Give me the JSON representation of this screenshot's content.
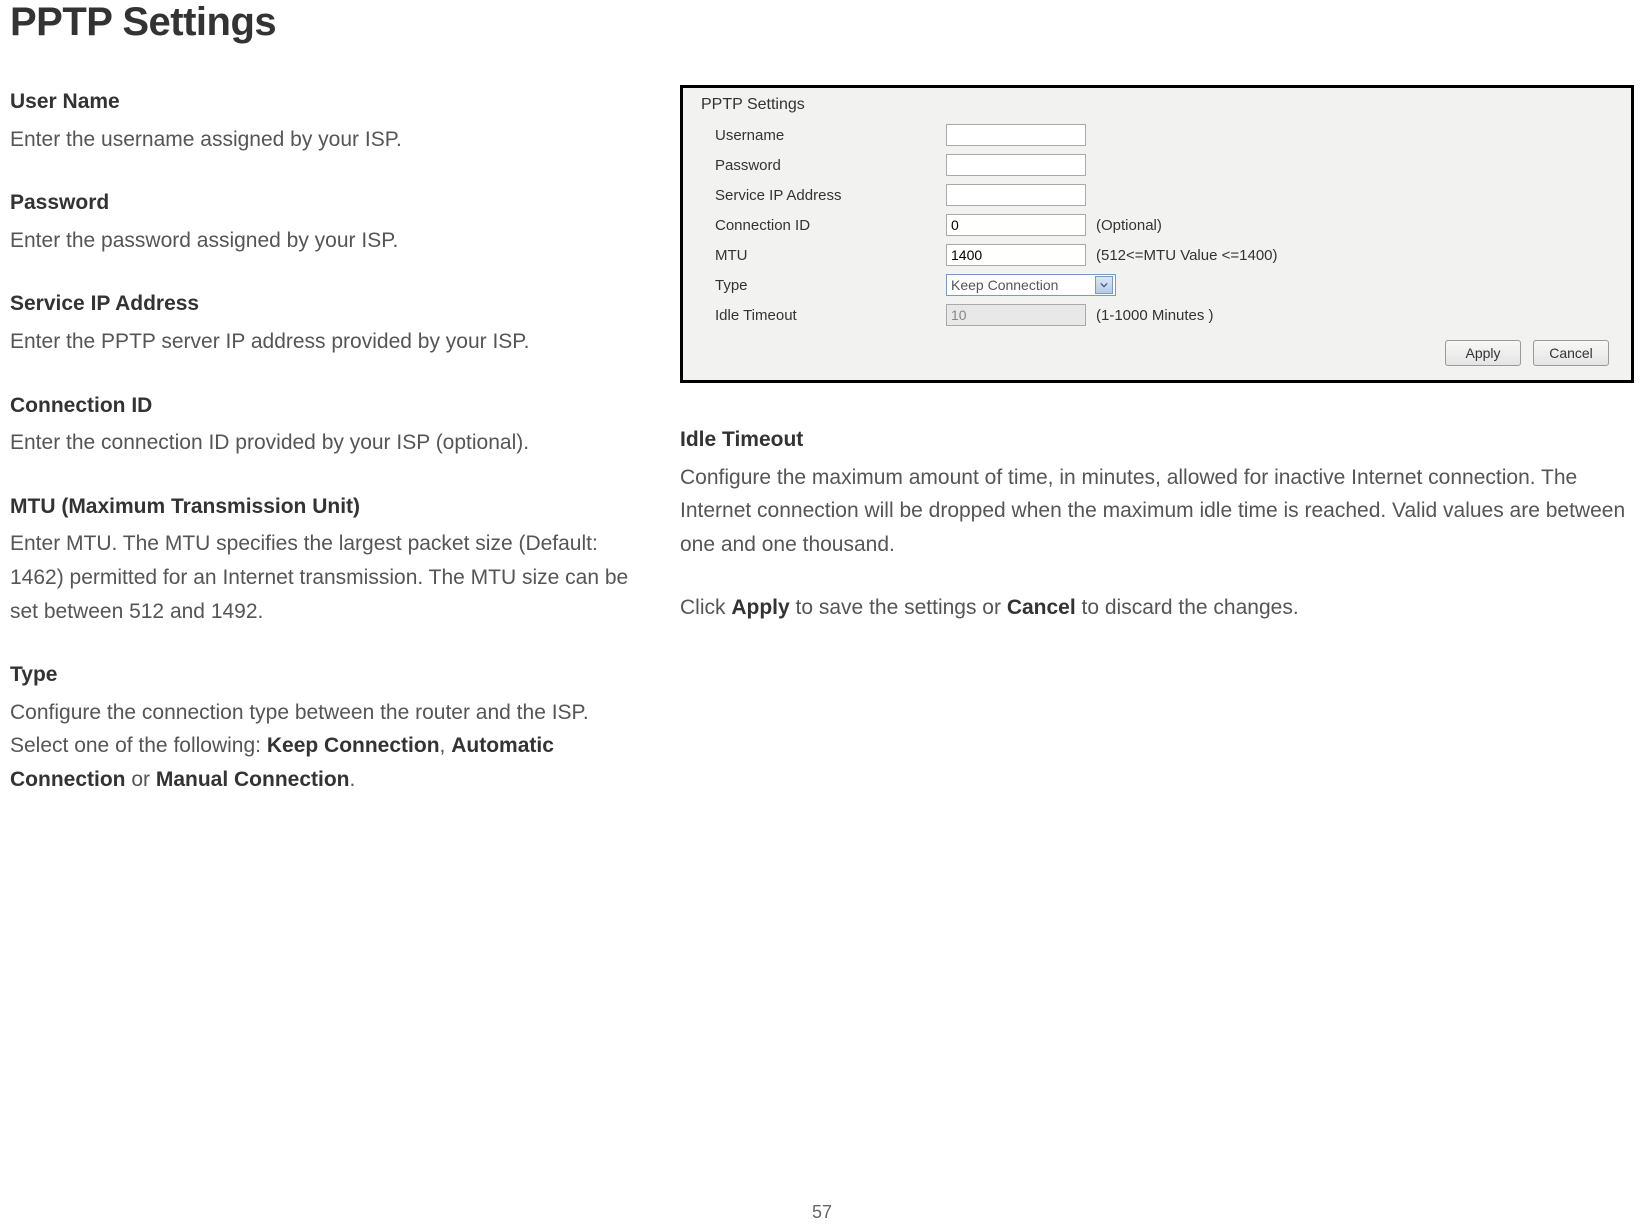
{
  "page": {
    "title": "PPTP Settings",
    "number": "57"
  },
  "left": {
    "username": {
      "label": "User Name",
      "body": "Enter the username assigned by your ISP."
    },
    "password": {
      "label": "Password",
      "body": "Enter the password assigned by your ISP."
    },
    "service_ip": {
      "label": "Service IP Address",
      "body": "Enter the PPTP server IP address provided by your ISP."
    },
    "connection_id": {
      "label": "Connection ID",
      "body": "Enter the connection ID provided by your ISP (optional)."
    },
    "mtu": {
      "label": "MTU (Maximum Transmission Unit)",
      "body": "Enter MTU. The MTU specifies the largest packet size (Default: 1462) permitted for an Internet transmission. The MTU size can be set between 512 and 1492."
    },
    "type": {
      "label": "Type",
      "pre": "Configure the connection type between the router and the ISP. Select one of the following: ",
      "b1": "Keep Connection",
      "sep1": ", ",
      "b2": "Automatic Connection",
      "sep2": " or ",
      "b3": "Manual Connection",
      "post": "."
    }
  },
  "panel": {
    "legend": "PPTP Settings",
    "rows": {
      "username": {
        "label": "Username",
        "value": ""
      },
      "password": {
        "label": "Password",
        "value": ""
      },
      "service_ip": {
        "label": "Service IP Address",
        "value": ""
      },
      "connection_id": {
        "label": "Connection ID",
        "value": "0",
        "hint": "(Optional)"
      },
      "mtu": {
        "label": "MTU",
        "value": "1400",
        "hint": "(512<=MTU Value <=1400)"
      },
      "type": {
        "label": "Type",
        "value": "Keep Connection"
      },
      "idle": {
        "label": "Idle Timeout",
        "value": "10",
        "hint": "(1-1000 Minutes )"
      }
    },
    "buttons": {
      "apply": "Apply",
      "cancel": "Cancel"
    }
  },
  "right": {
    "idle": {
      "label": "Idle Timeout",
      "body": "Configure the maximum amount of time, in minutes, allowed for inactive Internet connection. The Internet connection will be dropped when the maximum idle time is reached. Valid values are between one and one thousand."
    },
    "closing": {
      "pre": "Click ",
      "b1": "Apply",
      "mid": " to save the settings or ",
      "b2": "Cancel",
      "post": " to discard the changes."
    }
  }
}
